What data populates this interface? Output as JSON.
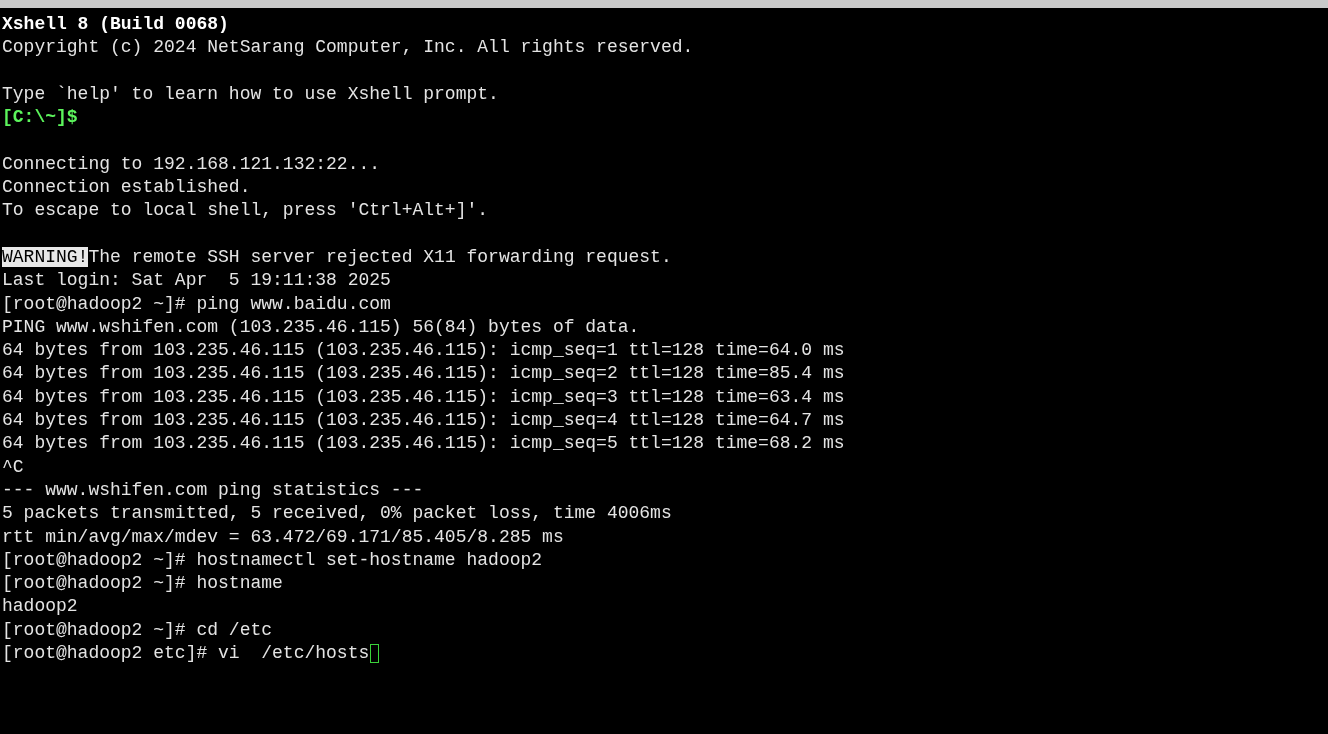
{
  "terminal": {
    "lines": [
      {
        "kind": "bold",
        "text": "Xshell 8 (Build 0068)"
      },
      {
        "kind": "text",
        "text": "Copyright (c) 2024 NetSarang Computer, Inc. All rights reserved."
      },
      {
        "kind": "blank"
      },
      {
        "kind": "text",
        "text": "Type `help' to learn how to use Xshell prompt."
      },
      {
        "kind": "prompt",
        "text": "[C:\\~]$"
      },
      {
        "kind": "blank"
      },
      {
        "kind": "text",
        "text": "Connecting to 192.168.121.132:22..."
      },
      {
        "kind": "text",
        "text": "Connection established."
      },
      {
        "kind": "text",
        "text": "To escape to local shell, press 'Ctrl+Alt+]'."
      },
      {
        "kind": "blank"
      },
      {
        "kind": "warning",
        "label": "WARNING!",
        "text": "The remote SSH server rejected X11 forwarding request."
      },
      {
        "kind": "text",
        "text": "Last login: Sat Apr  5 19:11:38 2025"
      },
      {
        "kind": "text",
        "text": "[root@hadoop2 ~]# ping www.baidu.com"
      },
      {
        "kind": "text",
        "text": "PING www.wshifen.com (103.235.46.115) 56(84) bytes of data."
      },
      {
        "kind": "text",
        "text": "64 bytes from 103.235.46.115 (103.235.46.115): icmp_seq=1 ttl=128 time=64.0 ms"
      },
      {
        "kind": "text",
        "text": "64 bytes from 103.235.46.115 (103.235.46.115): icmp_seq=2 ttl=128 time=85.4 ms"
      },
      {
        "kind": "text",
        "text": "64 bytes from 103.235.46.115 (103.235.46.115): icmp_seq=3 ttl=128 time=63.4 ms"
      },
      {
        "kind": "text",
        "text": "64 bytes from 103.235.46.115 (103.235.46.115): icmp_seq=4 ttl=128 time=64.7 ms"
      },
      {
        "kind": "text",
        "text": "64 bytes from 103.235.46.115 (103.235.46.115): icmp_seq=5 ttl=128 time=68.2 ms"
      },
      {
        "kind": "text",
        "text": "^C"
      },
      {
        "kind": "text",
        "text": "--- www.wshifen.com ping statistics ---"
      },
      {
        "kind": "text",
        "text": "5 packets transmitted, 5 received, 0% packet loss, time 4006ms"
      },
      {
        "kind": "text",
        "text": "rtt min/avg/max/mdev = 63.472/69.171/85.405/8.285 ms"
      },
      {
        "kind": "text",
        "text": "[root@hadoop2 ~]# hostnamectl set-hostname hadoop2"
      },
      {
        "kind": "text",
        "text": "[root@hadoop2 ~]# hostname"
      },
      {
        "kind": "text",
        "text": "hadoop2"
      },
      {
        "kind": "text",
        "text": "[root@hadoop2 ~]# cd /etc"
      },
      {
        "kind": "input",
        "text": "[root@hadoop2 etc]# vi  /etc/hosts",
        "cursor": true
      }
    ]
  }
}
